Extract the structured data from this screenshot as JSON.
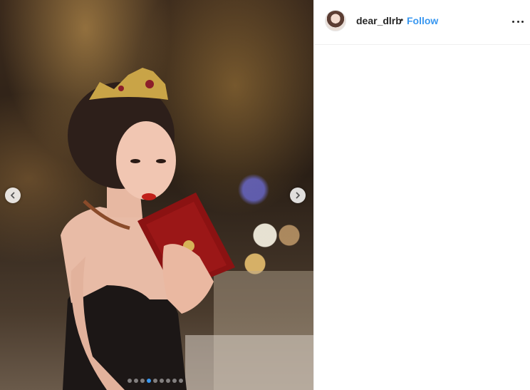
{
  "post": {
    "carousel": {
      "dot_count": 9,
      "active_dot_index": 3
    }
  },
  "header": {
    "username": "dear_dlrb",
    "separator": "•",
    "follow_label": "Follow"
  },
  "icons": {
    "prev": "chevron-left-icon",
    "next": "chevron-right-icon",
    "more": "more-options-icon"
  },
  "colors": {
    "accent": "#3897f0",
    "text": "#262626"
  }
}
